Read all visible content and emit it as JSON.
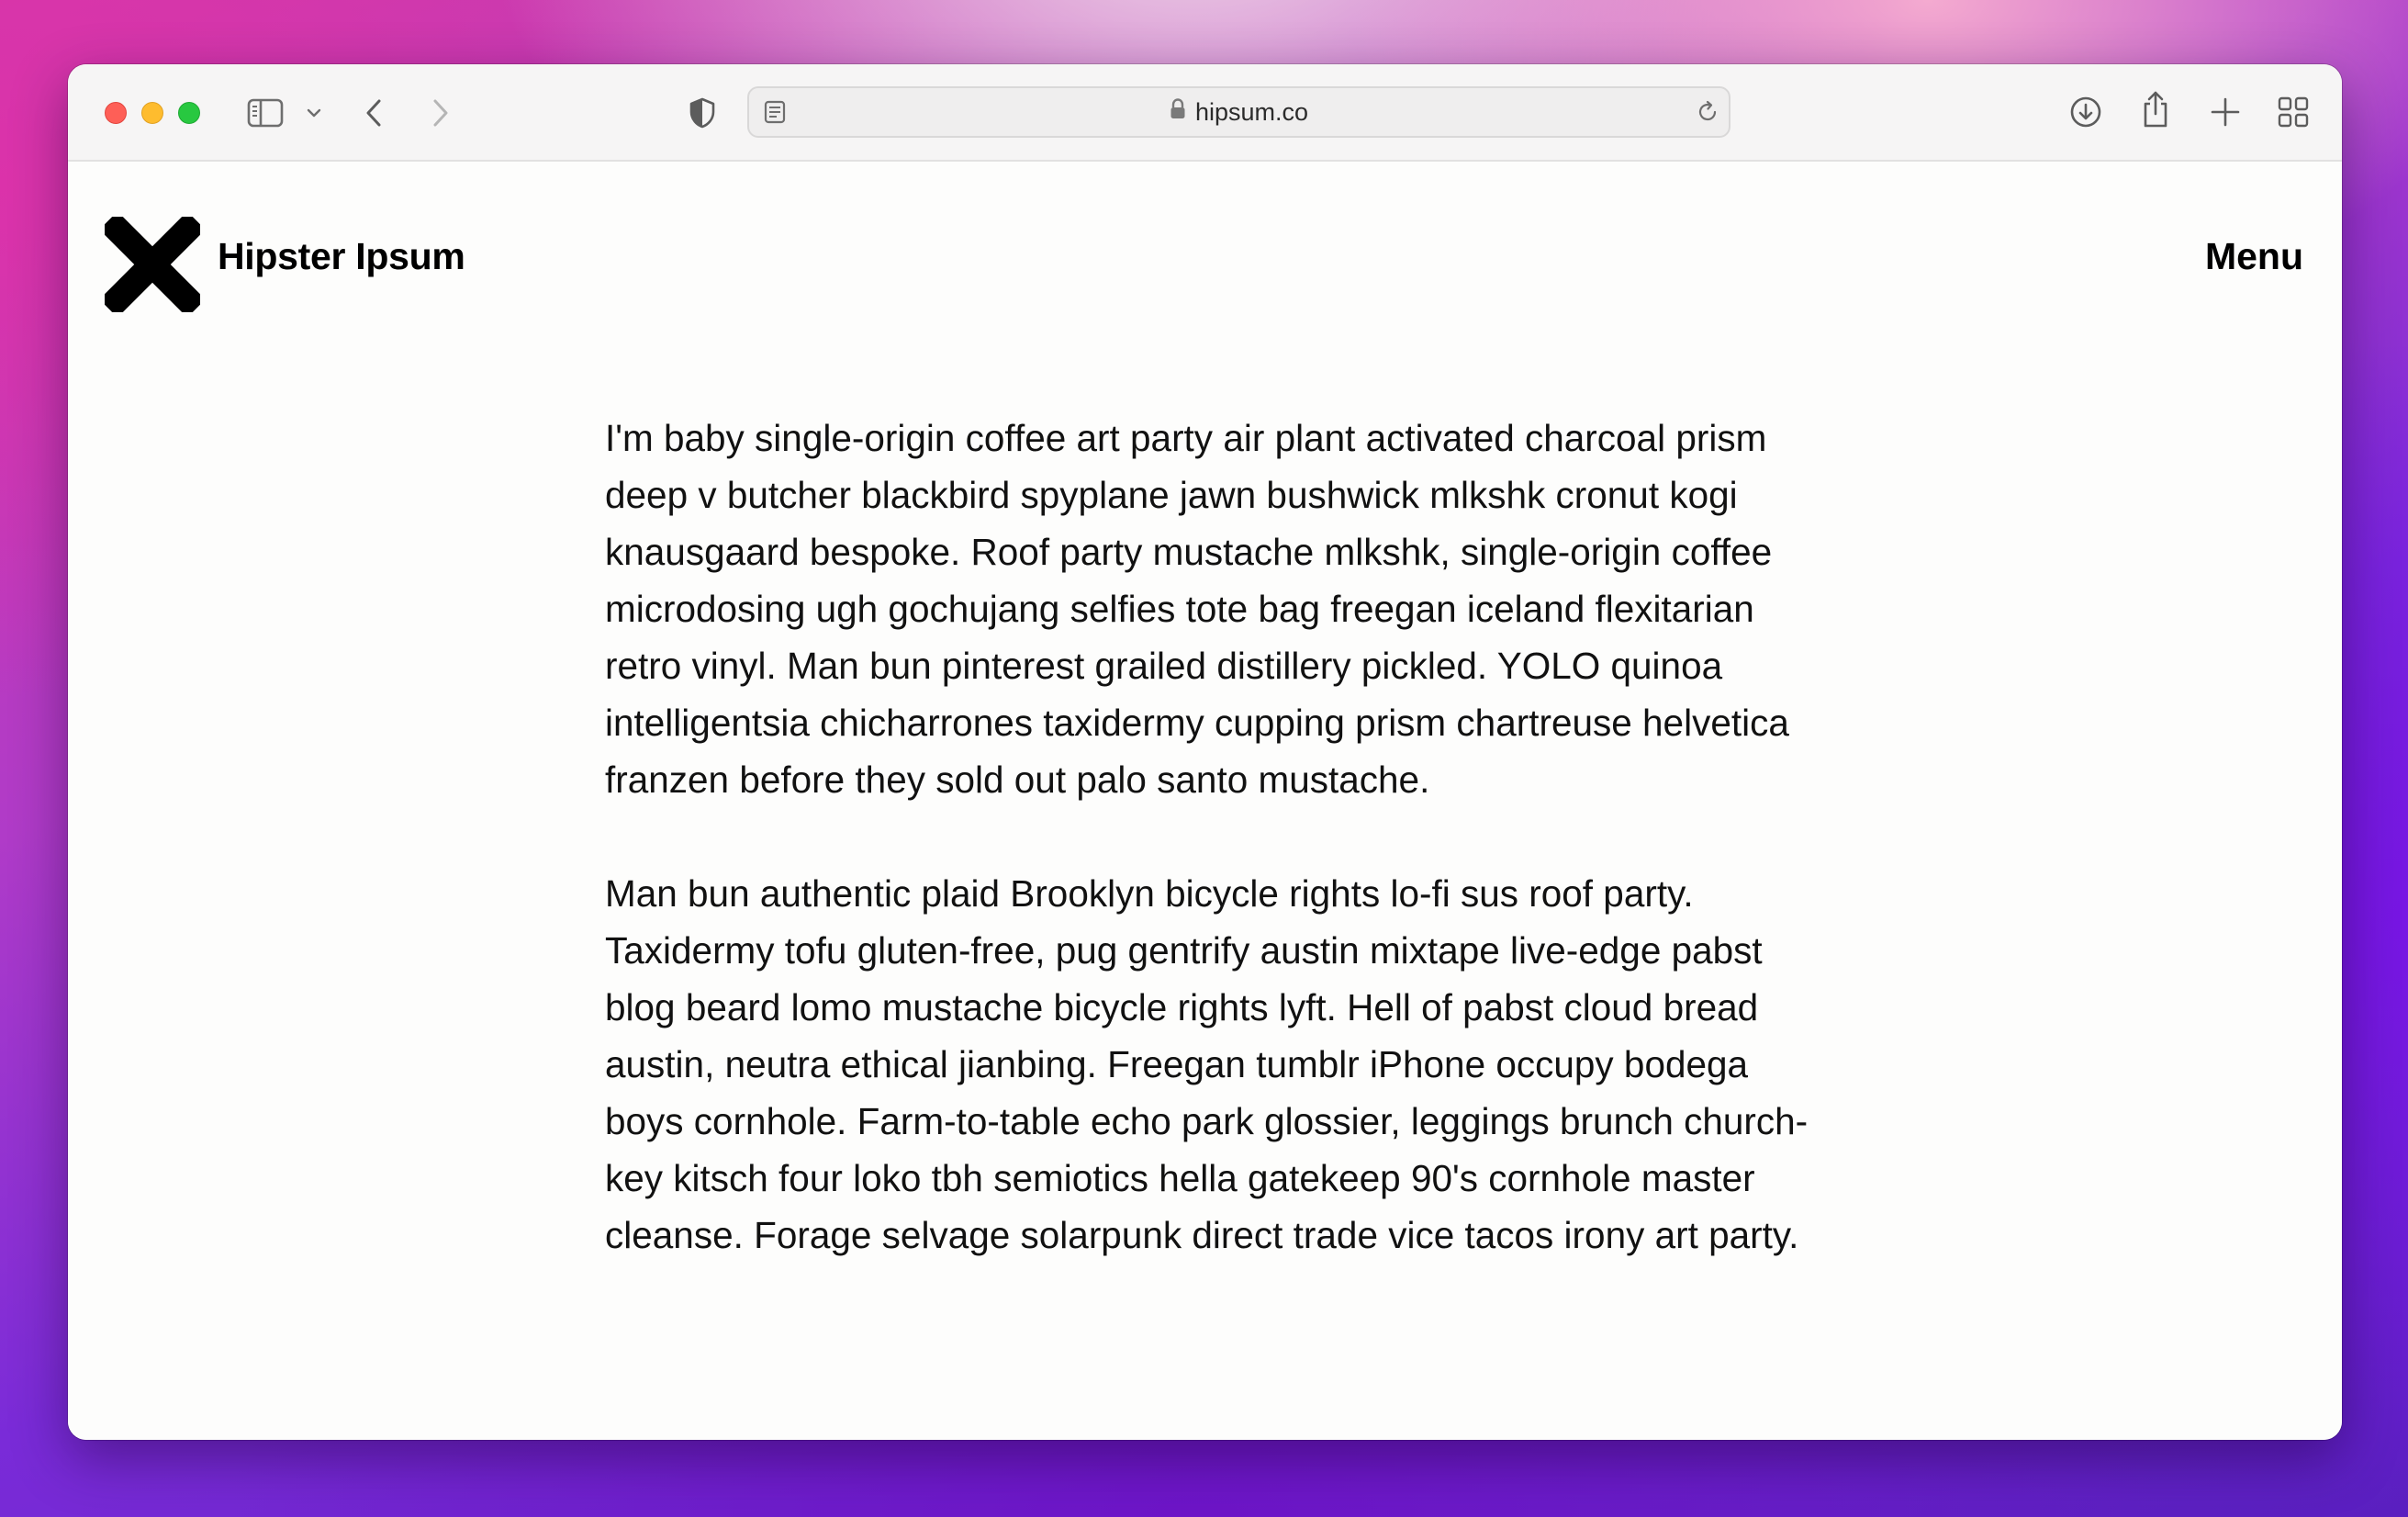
{
  "browser": {
    "url": "hipsum.co",
    "icons": [
      "close-icon",
      "minimize-icon",
      "zoom-icon",
      "sidebar-icon",
      "chevron-down-icon",
      "back-icon",
      "forward-icon",
      "shield-icon",
      "reader-icon",
      "lock-icon",
      "reload-icon",
      "download-icon",
      "share-icon",
      "new-tab-icon",
      "tab-overview-icon"
    ]
  },
  "site": {
    "brand": "Hipster Ipsum",
    "menu_label": "Menu"
  },
  "content": {
    "paragraphs": [
      "I'm baby single-origin coffee art party air plant activated charcoal prism deep v butcher blackbird spyplane jawn bushwick mlkshk cronut kogi knausgaard bespoke. Roof party mustache mlkshk, single-origin coffee microdosing ugh gochujang selfies tote bag freegan iceland flexitarian retro vinyl. Man bun pinterest grailed distillery pickled. YOLO quinoa intelligentsia chicharrones taxidermy cupping prism chartreuse helvetica franzen before they sold out palo santo mustache.",
      "Man bun authentic plaid Brooklyn bicycle rights lo-fi sus roof party. Taxidermy tofu gluten-free, pug gentrify austin mixtape live-edge pabst blog beard lomo mustache bicycle rights lyft. Hell of pabst cloud bread austin, neutra ethical jianbing. Freegan tumblr iPhone occupy bodega boys cornhole. Farm-to-table echo park glossier, leggings brunch church-key kitsch four loko tbh semiotics hella gatekeep 90's cornhole master cleanse. Forage selvage solarpunk direct trade vice tacos irony art party."
    ]
  },
  "colors": {
    "close": "#fe5f57",
    "minimize": "#febc2e",
    "zoom": "#28c840",
    "page_bg": "#fdfdfc",
    "text": "#111111"
  }
}
